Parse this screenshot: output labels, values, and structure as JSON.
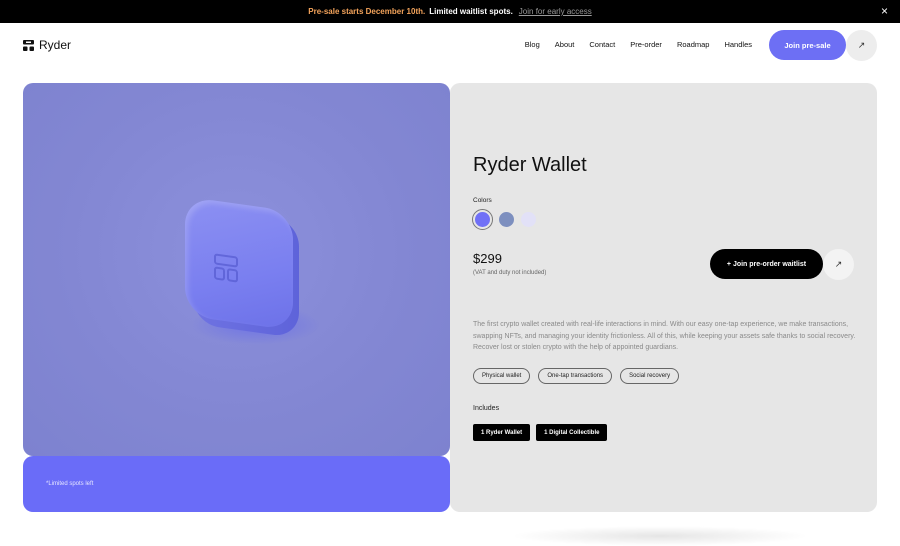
{
  "announcement": {
    "highlight": "Pre-sale starts December 10th.",
    "message": "Limited waitlist spots.",
    "link": "Join for early access",
    "close": "×"
  },
  "header": {
    "brand": "Ryder",
    "nav": [
      "Blog",
      "About",
      "Contact",
      "Pre-order",
      "Roadmap",
      "Handles"
    ],
    "cta_label": "Join pre-sale",
    "cta_arrow": "↗"
  },
  "hero": {
    "strip_note": "*Limited spots left"
  },
  "product": {
    "title": "Ryder Wallet",
    "colors_label": "Colors",
    "colors": [
      "#7070f6",
      "#7d8fbf",
      "#e2e1f7"
    ],
    "selected_color_index": 0,
    "price": "$299",
    "price_note": "(VAT and duty not included)",
    "waitlist_button": "+ Join pre-order waitlist",
    "waitlist_arrow": "↗",
    "description": "The first crypto wallet created with real-life interactions in mind. With our easy one-tap experience, we make transactions, swapping NFTs, and managing your identity frictionless. All of this, while keeping your assets safe thanks to social recovery. Recover lost or stolen crypto with the help of appointed guardians.",
    "tags": [
      "Physical wallet",
      "One-tap transactions",
      "Social recovery"
    ],
    "includes_label": "Includes",
    "includes": [
      "1 Ryder Wallet",
      "1 Digital Collectible"
    ]
  },
  "colors": {
    "accent": "#6d6ff4",
    "announce_highlight": "#f5a45b",
    "hero_bg": "#8387d3",
    "strip_bg": "#6a6cf8",
    "panel_bg": "#e6e6e6"
  }
}
